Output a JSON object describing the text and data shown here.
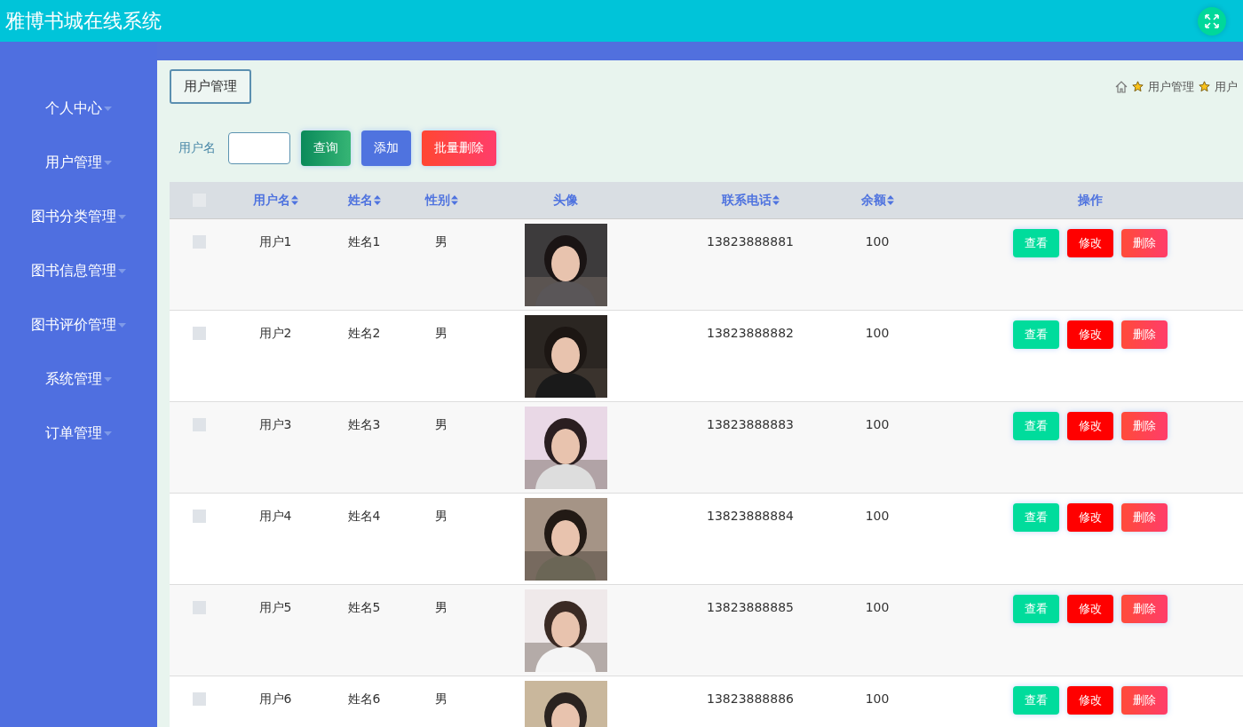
{
  "header": {
    "title": "雅博书城在线系统"
  },
  "sidebar": {
    "items": [
      {
        "label": "个人中心",
        "expanded": false
      },
      {
        "label": "用户管理",
        "expanded": false
      },
      {
        "label": "图书分类管理",
        "expanded": false
      },
      {
        "label": "图书信息管理",
        "expanded": false
      },
      {
        "label": "图书评价管理",
        "expanded": false
      },
      {
        "label": "系统管理",
        "expanded": false
      },
      {
        "label": "订单管理",
        "expanded": false
      }
    ]
  },
  "page_title": "用户管理",
  "breadcrumb": [
    "用户管理",
    "用户"
  ],
  "search": {
    "label": "用户名",
    "buttons": [
      {
        "label": "查询",
        "kind": "query"
      },
      {
        "label": "添加",
        "kind": "add"
      },
      {
        "label": "批量删除",
        "kind": "delete"
      }
    ]
  },
  "table": {
    "select_all": {
      "checked": false
    },
    "columns": [
      {
        "label": "用户名",
        "sortable": true
      },
      {
        "label": "姓名",
        "sortable": true
      },
      {
        "label": "性别",
        "sortable": true
      },
      {
        "label": "头像",
        "sortable": false
      },
      {
        "label": "联系电话",
        "sortable": true
      },
      {
        "label": "余额",
        "sortable": true
      },
      {
        "label": "操作",
        "sortable": false
      }
    ],
    "rows": [
      {
        "selected": false,
        "username": "用户1",
        "name": "姓名1",
        "gender": "男",
        "phone": "13823888881",
        "balance": "100",
        "actions": [
          "查看",
          "修改",
          "删除"
        ]
      },
      {
        "selected": false,
        "username": "用户2",
        "name": "姓名2",
        "gender": "男",
        "phone": "13823888882",
        "balance": "100",
        "actions": [
          "查看",
          "修改",
          "删除"
        ]
      },
      {
        "selected": false,
        "username": "用户3",
        "name": "姓名3",
        "gender": "男",
        "phone": "13823888883",
        "balance": "100",
        "actions": [
          "查看",
          "修改",
          "删除"
        ]
      },
      {
        "selected": false,
        "username": "用户4",
        "name": "姓名4",
        "gender": "男",
        "phone": "13823888884",
        "balance": "100",
        "actions": [
          "查看",
          "修改",
          "删除"
        ]
      },
      {
        "selected": false,
        "username": "用户5",
        "name": "姓名5",
        "gender": "男",
        "phone": "13823888885",
        "balance": "100",
        "actions": [
          "查看",
          "修改",
          "删除"
        ]
      },
      {
        "selected": false,
        "username": "用户6",
        "name": "姓名6",
        "gender": "男",
        "phone": "13823888886",
        "balance": "100",
        "actions": [
          "查看",
          "修改",
          "删除"
        ]
      }
    ]
  }
}
